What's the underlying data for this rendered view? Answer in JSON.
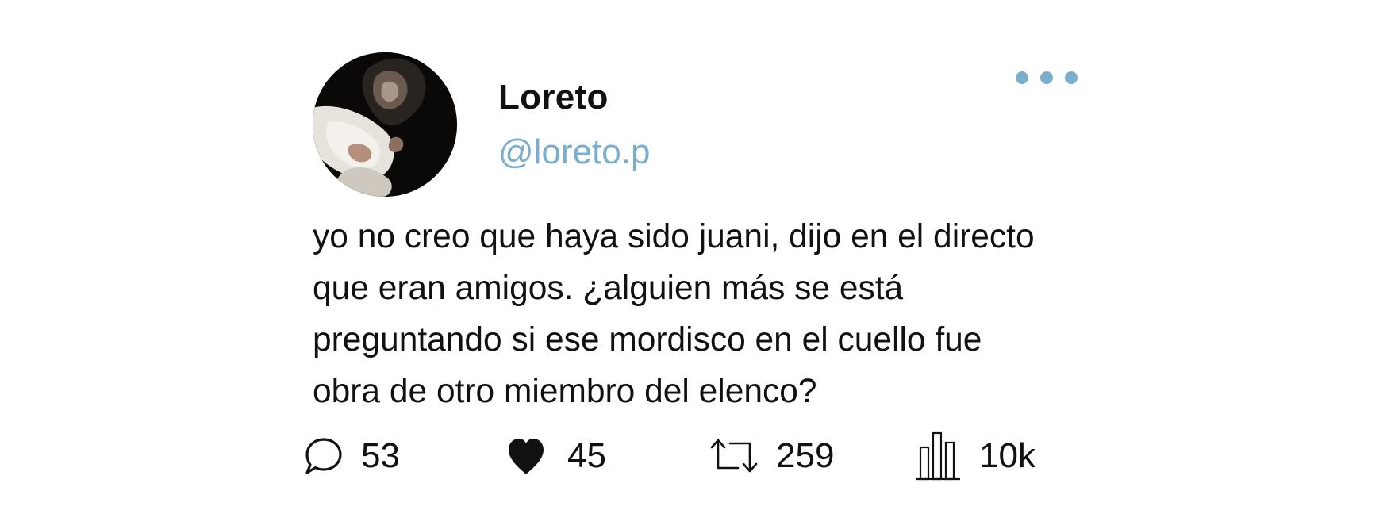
{
  "theme": {
    "accent": "#7aaecf",
    "text": "#111111",
    "background": "#ffffff"
  },
  "user": {
    "display_name": "Loreto",
    "handle": "@loreto.p",
    "avatar_icon": "profile-photo"
  },
  "menu": {
    "icon": "more-horizontal-icon"
  },
  "tweet": {
    "text": "yo no creo que haya sido juani, dijo en el directo\nque eran amigos. ¿alguien más se está\npreguntando si ese mordisco en el cuello fue\nobra de otro miembro del elenco?"
  },
  "stats": {
    "replies": "53",
    "likes": "45",
    "reposts": "259",
    "views": "10k"
  },
  "icons": {
    "replies": "speech-bubble-icon",
    "likes": "heart-icon",
    "reposts": "repost-arrows-icon",
    "views": "bar-chart-icon"
  }
}
